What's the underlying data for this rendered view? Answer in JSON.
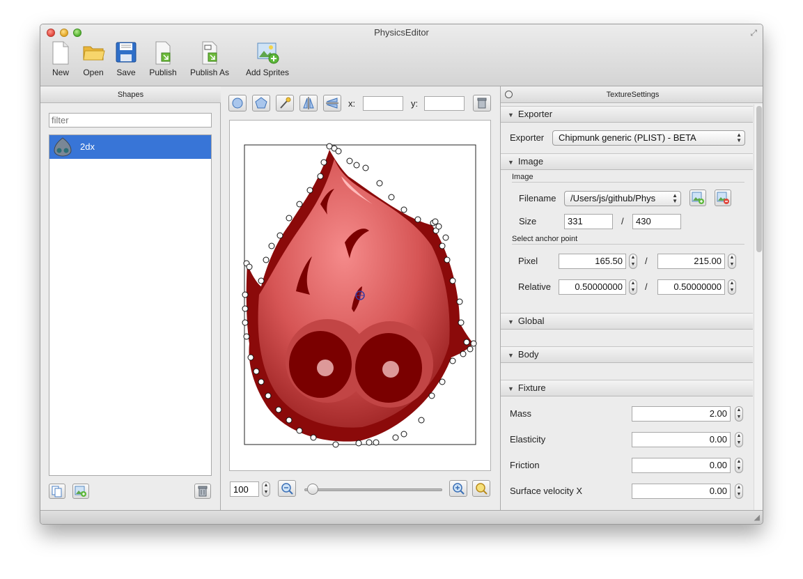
{
  "window": {
    "title": "PhysicsEditor"
  },
  "toolbar": {
    "items": [
      {
        "label": "New",
        "icon": "new-document-icon"
      },
      {
        "label": "Open",
        "icon": "folder-icon"
      },
      {
        "label": "Save",
        "icon": "floppy-disk-icon"
      },
      {
        "label": "Publish",
        "icon": "publish-icon"
      },
      {
        "label": "Publish As",
        "icon": "publish-as-icon"
      },
      {
        "label": "Add Sprites",
        "icon": "add-sprites-icon"
      }
    ]
  },
  "shapes_panel": {
    "title": "Shapes",
    "filter_placeholder": "filter",
    "items": [
      {
        "label": "2dx"
      }
    ]
  },
  "editor": {
    "x_label": "x:",
    "y_label": "y:",
    "x_value": "",
    "y_value": "",
    "zoom_value": "100"
  },
  "settings": {
    "title": "TextureSettings",
    "exporter_section": "Exporter",
    "exporter_label": "Exporter",
    "exporter_value": "Chipmunk generic (PLIST) - BETA",
    "image_section": "Image",
    "image_sublabel": "Image",
    "filename_label": "Filename",
    "filename_value": "/Users/js/github/Phys",
    "size_label": "Size",
    "size_w": "331",
    "size_sep": "/",
    "size_h": "430",
    "anchor_label": "Select anchor point",
    "pixel_label": "Pixel",
    "pixel_x": "165.50",
    "pixel_y": "215.00",
    "relative_label": "Relative",
    "relative_x": "0.50000000",
    "relative_y": "0.50000000",
    "global_section": "Global",
    "body_section": "Body",
    "fixture_section": "Fixture",
    "mass_label": "Mass",
    "mass_value": "2.00",
    "elasticity_label": "Elasticity",
    "elasticity_value": "0.00",
    "friction_label": "Friction",
    "friction_value": "0.00",
    "surface_velocity_label": "Surface velocity X",
    "surface_velocity_value": "0.00"
  }
}
